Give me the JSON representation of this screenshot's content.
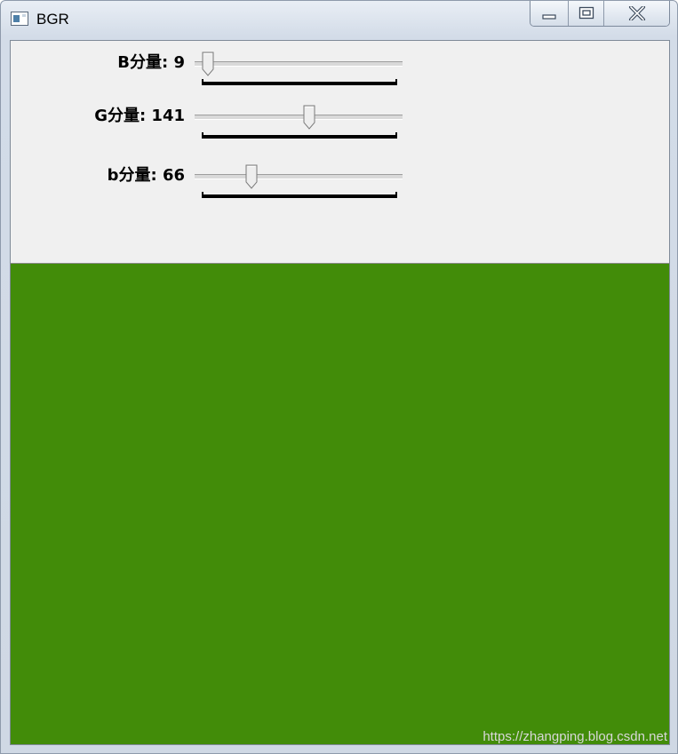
{
  "window": {
    "title": "BGR",
    "icons": {
      "app": "window-app-icon",
      "minimize": "minimize-icon",
      "maximize": "maximize-icon",
      "close": "close-icon"
    }
  },
  "trackbars": [
    {
      "id": "b",
      "label": "B分量: 9",
      "value": 9,
      "max": 255
    },
    {
      "id": "g",
      "label": "G分量: 141",
      "value": 141,
      "max": 255
    },
    {
      "id": "r",
      "label": "b分量: 66",
      "value": 66,
      "max": 255
    }
  ],
  "image": {
    "fill_color": "#428c09"
  },
  "watermark": "https://zhangping.blog.csdn.net"
}
